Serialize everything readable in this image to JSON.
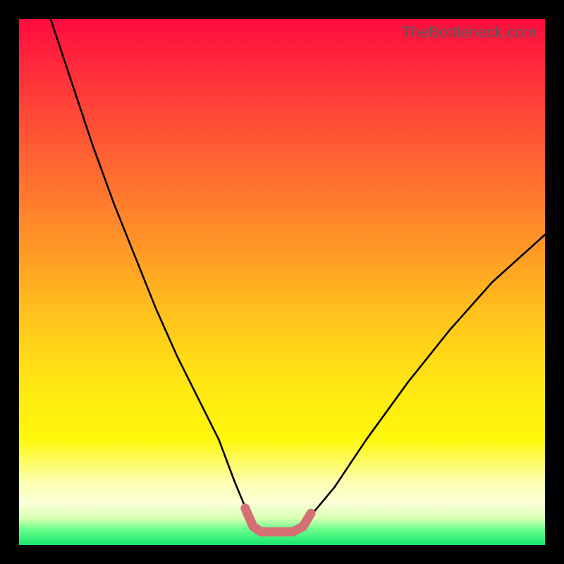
{
  "watermark": "TheBottleneck.com",
  "chart_data": {
    "type": "line",
    "title": "",
    "xlabel": "",
    "ylabel": "",
    "xlim": [
      0,
      100
    ],
    "ylim": [
      0,
      100
    ],
    "series": [
      {
        "name": "bottleneck-curve-black",
        "stroke": "#000000",
        "x": [
          6,
          10,
          14,
          18,
          22,
          26,
          30,
          34,
          38,
          41,
          43.5,
          46,
          49,
          52,
          55,
          60,
          66,
          74,
          82,
          90,
          100
        ],
        "values": [
          100,
          88,
          76,
          65,
          55,
          45,
          36,
          28,
          20,
          12,
          6,
          2.5,
          2.5,
          2.5,
          5,
          11,
          20,
          31,
          41,
          50,
          59
        ]
      },
      {
        "name": "bottleneck-curve-highlight",
        "stroke": "#d56f74",
        "x": [
          43,
          44.5,
          46,
          49,
          52,
          54,
          55.5
        ],
        "values": [
          7,
          3.5,
          2.5,
          2.5,
          2.5,
          3.5,
          6
        ]
      }
    ],
    "annotations": [],
    "grid": false,
    "legend": false
  },
  "colors": {
    "frame": "#000000",
    "gradient_top": "#ff0b3f",
    "gradient_bottom": "#16e56a",
    "curve": "#000000",
    "highlight": "#d56f74",
    "watermark": "#585858"
  }
}
